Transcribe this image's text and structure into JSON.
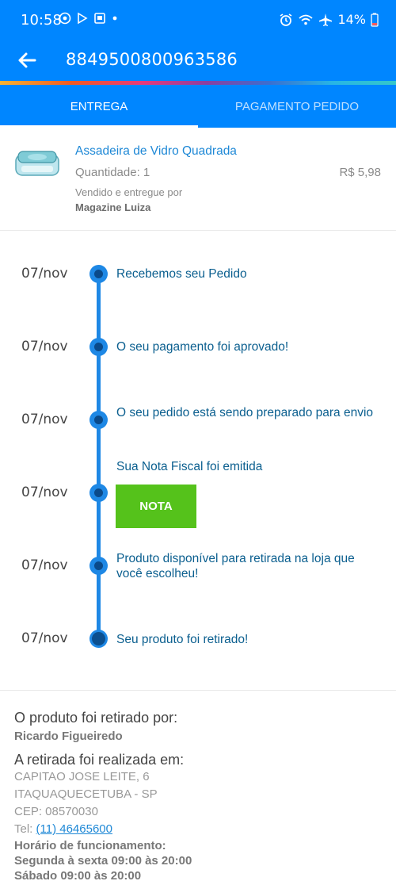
{
  "status_bar": {
    "time": "10:58",
    "battery": "14%",
    "icons": [
      "whatsapp-icon",
      "play-store-icon",
      "gallery-icon",
      "dot-icon",
      "alarm-icon",
      "wifi-icon",
      "airplane-icon",
      "battery-icon"
    ]
  },
  "header": {
    "order_number": "8849500800963586",
    "back_icon": "arrow-left-icon"
  },
  "tabs": [
    {
      "label": "ENTREGA",
      "active": true
    },
    {
      "label": "PAGAMENTO PEDIDO",
      "active": false
    }
  ],
  "product": {
    "name": "Assadeira de Vidro Quadrada",
    "quantity": "Quantidade: 1",
    "price": "R$ 5,98",
    "sold_by_label": "Vendido e entregue por",
    "seller": "Magazine Luiza"
  },
  "timeline": [
    {
      "date": "07/nov",
      "text": "Recebemos seu Pedido"
    },
    {
      "date": "07/nov",
      "text": "O seu pagamento foi aprovado!"
    },
    {
      "date": "07/nov",
      "text": "O seu pedido está sendo preparado para envio"
    },
    {
      "date": "07/nov",
      "text": "Sua Nota Fiscal foi emitida",
      "button": "NOTA"
    },
    {
      "date": "07/nov",
      "text": "Produto disponível para retirada na loja que você escolheu!"
    },
    {
      "date": "07/nov",
      "text": "Seu produto foi retirado!"
    }
  ],
  "pickup": {
    "picked_by_label": "O produto foi retirado por:",
    "picked_by_name": "Ricardo Figueiredo",
    "location_label": "A retirada foi realizada em:",
    "address_line1": "CAPITAO JOSE LEITE, 6",
    "address_line2": "ITAQUAQUECETUBA - SP",
    "cep": "CEP: 08570030",
    "tel_label": "Tel:",
    "tel": "(11) 46465600",
    "hours_label": "Horário de funcionamento:",
    "hours_weekday": "Segunda à sexta 09:00 às 20:00",
    "hours_saturday": "Sábado 09:00 às 20:00"
  },
  "colors": {
    "primary": "#0086ff",
    "timeline": "#1e88e5",
    "nota_button": "#55c21b",
    "link": "#1e88d6"
  }
}
